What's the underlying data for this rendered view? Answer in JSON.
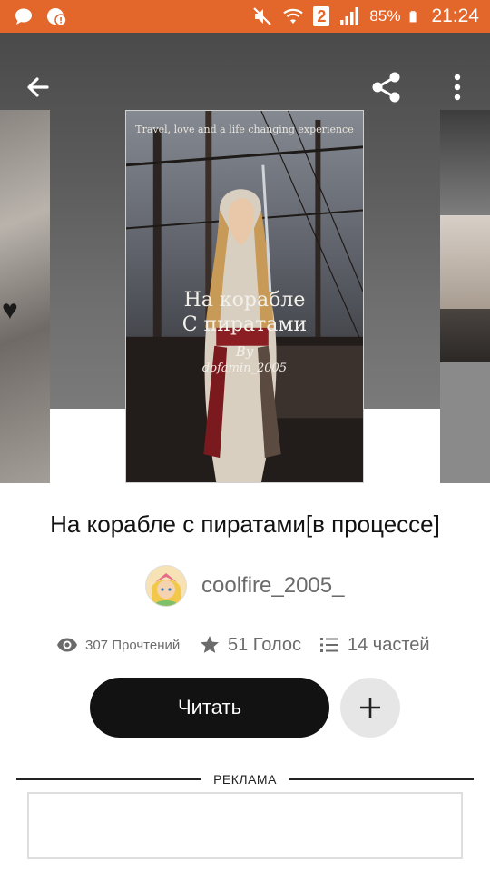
{
  "status_bar": {
    "left_icons": [
      "chat-bubble-icon",
      "notification-badge-icon"
    ],
    "right_icons": [
      "vibrate-mute-icon",
      "wifi-icon",
      "sim-2-icon",
      "signal-icon",
      "battery-icon"
    ],
    "sim_label": "2",
    "battery": "85%",
    "time": "21:24",
    "color": "#e3672b"
  },
  "toolbar": {
    "back_icon": "arrow-left-icon",
    "share_icon": "share-icon",
    "menu_icon": "more-vertical-icon"
  },
  "cover": {
    "tagline": "Travel, love and a life changing experience",
    "title_line1": "На корабле",
    "title_line2": "С пиратами",
    "by": "By",
    "author": "dofamin_2005"
  },
  "story": {
    "title": "На корабле с пиратами[в процессе]",
    "author": "coolfire_2005_",
    "stats": {
      "reads": "307 Прочтений",
      "votes": "51 Голос",
      "parts": "14 частей"
    },
    "read_button": "Читать",
    "add_button_icon": "plus-icon"
  },
  "ad": {
    "label": "РЕКЛАМА"
  }
}
